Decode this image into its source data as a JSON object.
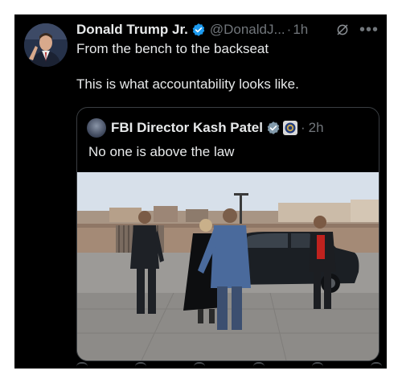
{
  "post": {
    "author_name": "Donald Trump Jr.",
    "handle": "@DonaldJ...",
    "separator": "·",
    "time": "1h",
    "text_line1": "From the bench to the backseat",
    "text_line2": "This is what accountability looks like."
  },
  "quote": {
    "author_name": "FBI Director Kash Patel",
    "separator": "·",
    "time": "2h",
    "text": "No one is above the law"
  },
  "icons": {
    "verified": "verified-badge-icon",
    "grok": "grok-icon",
    "more": "more-icon",
    "government_badge": "fbi-seal-icon"
  },
  "colors": {
    "background": "#000000",
    "text": "#e7e9ea",
    "muted": "#71767b",
    "verified_blue": "#1d9bf0",
    "verified_gray": "#829aab",
    "border": "#3a3e42"
  }
}
